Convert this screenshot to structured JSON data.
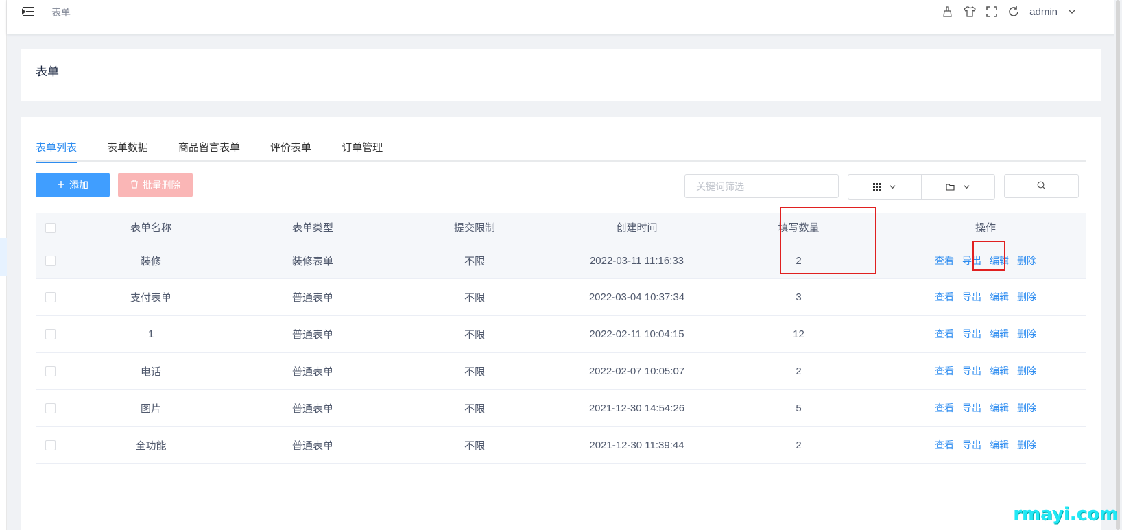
{
  "topbar": {
    "breadcrumb": "表单",
    "user": "admin",
    "icons": [
      "clean-icon",
      "theme-icon",
      "fullscreen-icon",
      "refresh-icon"
    ]
  },
  "header": {
    "title": "表单"
  },
  "tabs": [
    {
      "label": "表单列表",
      "active": true
    },
    {
      "label": "表单数据",
      "active": false
    },
    {
      "label": "商品留言表单",
      "active": false
    },
    {
      "label": "评价表单",
      "active": false
    },
    {
      "label": "订单管理",
      "active": false
    }
  ],
  "toolbar": {
    "add_label": "添加",
    "batch_delete_label": "批量删除",
    "search_placeholder": "关键词筛选"
  },
  "table": {
    "headers": [
      "表单名称",
      "表单类型",
      "提交限制",
      "创建时间",
      "填写数量",
      "操作"
    ],
    "rows": [
      {
        "name": "装修",
        "type": "装修表单",
        "limit": "不限",
        "created": "2022-03-11 11:16:33",
        "count": "2"
      },
      {
        "name": "支付表单",
        "type": "普通表单",
        "limit": "不限",
        "created": "2022-03-04 10:37:34",
        "count": "3"
      },
      {
        "name": "1",
        "type": "普通表单",
        "limit": "不限",
        "created": "2022-02-11 10:04:15",
        "count": "12"
      },
      {
        "name": "电话",
        "type": "普通表单",
        "limit": "不限",
        "created": "2022-02-07 10:05:07",
        "count": "2"
      },
      {
        "name": "图片",
        "type": "普通表单",
        "limit": "不限",
        "created": "2021-12-30 14:54:26",
        "count": "5"
      },
      {
        "name": "全功能",
        "type": "普通表单",
        "limit": "不限",
        "created": "2021-12-30 11:39:44",
        "count": "2"
      }
    ],
    "actions": [
      "查看",
      "导出",
      "编辑",
      "删除"
    ]
  },
  "watermark": "rmayi.com",
  "colors": {
    "accent": "#2d8cf0",
    "primary_button": "#409eff",
    "danger_disabled": "#fab6b6",
    "highlight": "#e02020"
  }
}
